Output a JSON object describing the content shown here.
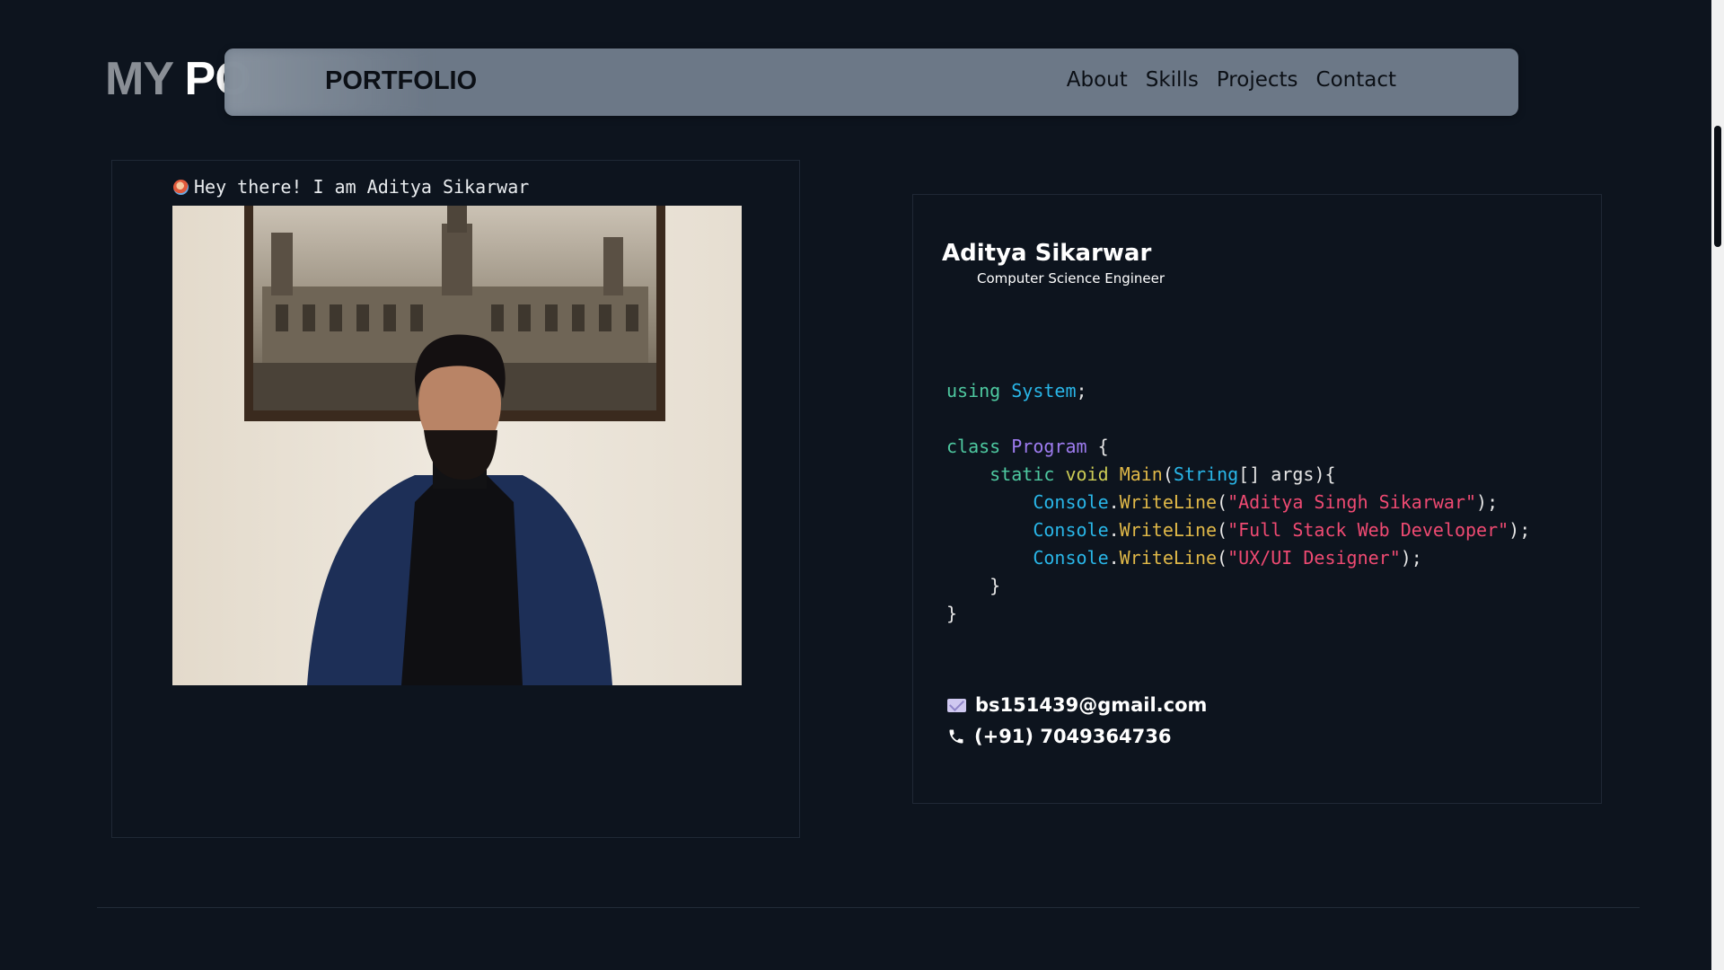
{
  "header": {
    "brand_under_my": "MY",
    "brand_under_po": "PO",
    "brand": "PORTFOLIO",
    "nav": [
      "About",
      "Skills",
      "Projects",
      "Contact"
    ]
  },
  "intro": {
    "greeting": "Hey there! I am Aditya Sikarwar"
  },
  "profile": {
    "name": "Aditya Sikarwar",
    "role": "Computer Science Engineer"
  },
  "code": {
    "using": "using",
    "system": "System",
    "class_kw": "class",
    "program": "Program",
    "static_kw": "static",
    "void_kw": "void",
    "main": "Main",
    "string_type": "String",
    "args": "args",
    "console": "Console",
    "writeline": "WriteLine",
    "lines": [
      "\"Aditya Singh Sikarwar\"",
      "\"Full Stack Web Developer\"",
      "\"UX/UI Designer\""
    ]
  },
  "contact": {
    "email": "bs151439@gmail.com",
    "phone": "(+91) 7049364736"
  },
  "colors": {
    "background": "#0d141e",
    "nav": "#707c8a",
    "keyword": "#4ec9a0",
    "string": "#ef4a72"
  }
}
